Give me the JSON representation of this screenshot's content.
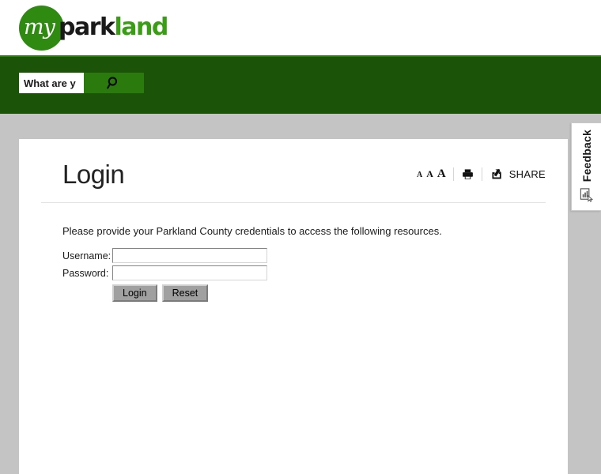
{
  "site": {
    "logo": {
      "script_word": "my",
      "bold_word_dark": "park",
      "bold_word_green": "land",
      "circle_color": "#2f8a12",
      "dark_color": "#1a1a1a",
      "green_color": "#3a9e14"
    }
  },
  "search": {
    "value": "What are y",
    "placeholder": "What are you looking for?",
    "button_icon": "search-icon",
    "bar_color": "#1b5409",
    "button_color": "#2a7a0e"
  },
  "page": {
    "title": "Login"
  },
  "tools": {
    "font_small": "A",
    "font_medium": "A",
    "font_large": "A",
    "print_icon": "printer-icon",
    "share_icon": "share-icon",
    "share_label": "SHARE"
  },
  "login": {
    "intro": "Please provide your Parkland County credentials to access the following resources.",
    "username_label": "Username:",
    "username_value": "",
    "password_label": "Password:",
    "password_value": "",
    "submit_label": "Login",
    "reset_label": "Reset"
  },
  "feedback": {
    "label": "Feedback",
    "icon": "feedback-form-icon"
  }
}
